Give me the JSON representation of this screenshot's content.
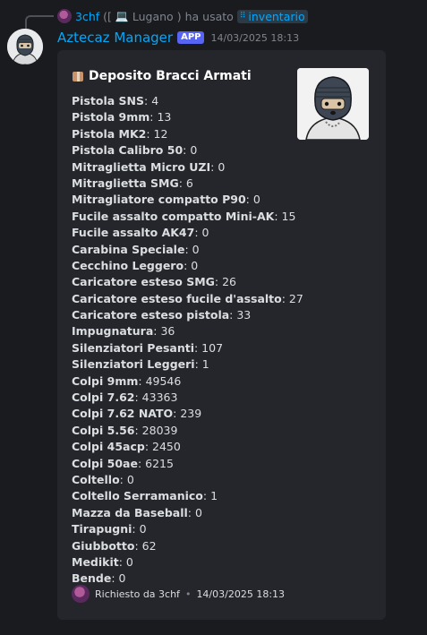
{
  "interaction": {
    "user": "3chf",
    "paren_open": "([",
    "location": "Lugano",
    "paren_close": ")",
    "action": "ha usato",
    "command": "inventario"
  },
  "message": {
    "author": "Aztecaz Manager",
    "tag": "APP",
    "timestamp": "14/03/2025 18:13"
  },
  "embed": {
    "title": "Deposito Bracci Armati",
    "title_icon": "package-icon",
    "fields": [
      {
        "name": "Pistola SNS",
        "value": "4"
      },
      {
        "name": "Pistola 9mm",
        "value": "13"
      },
      {
        "name": "Pistola MK2",
        "value": "12"
      },
      {
        "name": "Pistola Calibro 50",
        "value": "0"
      },
      {
        "name": "Mitraglietta Micro UZI",
        "value": "0"
      },
      {
        "name": "Mitraglietta SMG",
        "value": "6"
      },
      {
        "name": "Mitragliatore compatto P90",
        "value": "0"
      },
      {
        "name": "Fucile assalto compatto Mini-AK",
        "value": "15"
      },
      {
        "name": "Fucile assalto AK47",
        "value": "0"
      },
      {
        "name": "Carabina Speciale",
        "value": "0"
      },
      {
        "name": "Cecchino Leggero",
        "value": "0"
      },
      {
        "name": "Caricatore esteso SMG",
        "value": "26"
      },
      {
        "name": "Caricatore esteso fucile d'assalto",
        "value": "27"
      },
      {
        "name": "Caricatore esteso pistola",
        "value": "33"
      },
      {
        "name": "Impugnatura",
        "value": "36"
      },
      {
        "name": "Silenziatori Pesanti",
        "value": "107"
      },
      {
        "name": "Silenziatori Leggeri",
        "value": "1"
      },
      {
        "name": "Colpi 9mm",
        "value": "49546"
      },
      {
        "name": "Colpi 7.62",
        "value": "43363"
      },
      {
        "name": "Colpi 7.62 NATO",
        "value": "239"
      },
      {
        "name": "Colpi 5.56",
        "value": "28039"
      },
      {
        "name": "Colpi 45acp",
        "value": "2450"
      },
      {
        "name": "Colpi 50ae",
        "value": "6215"
      },
      {
        "name": "Coltello",
        "value": "0"
      },
      {
        "name": "Coltello Serramanico",
        "value": "1"
      },
      {
        "name": "Mazza da Baseball",
        "value": "0"
      },
      {
        "name": "Tirapugni",
        "value": "0"
      },
      {
        "name": "Giubbotto",
        "value": "62"
      },
      {
        "name": "Medikit",
        "value": "0"
      },
      {
        "name": "Bende",
        "value": "0"
      }
    ],
    "footer": {
      "requested_by": "Richiesto da 3chf",
      "separator": "•",
      "timestamp": "14/03/2025 18:13"
    }
  },
  "colors": {
    "background": "#1a1b1e",
    "embed_background": "#25262b",
    "link_blue": "#00a8fc",
    "app_tag": "#5865f2"
  }
}
